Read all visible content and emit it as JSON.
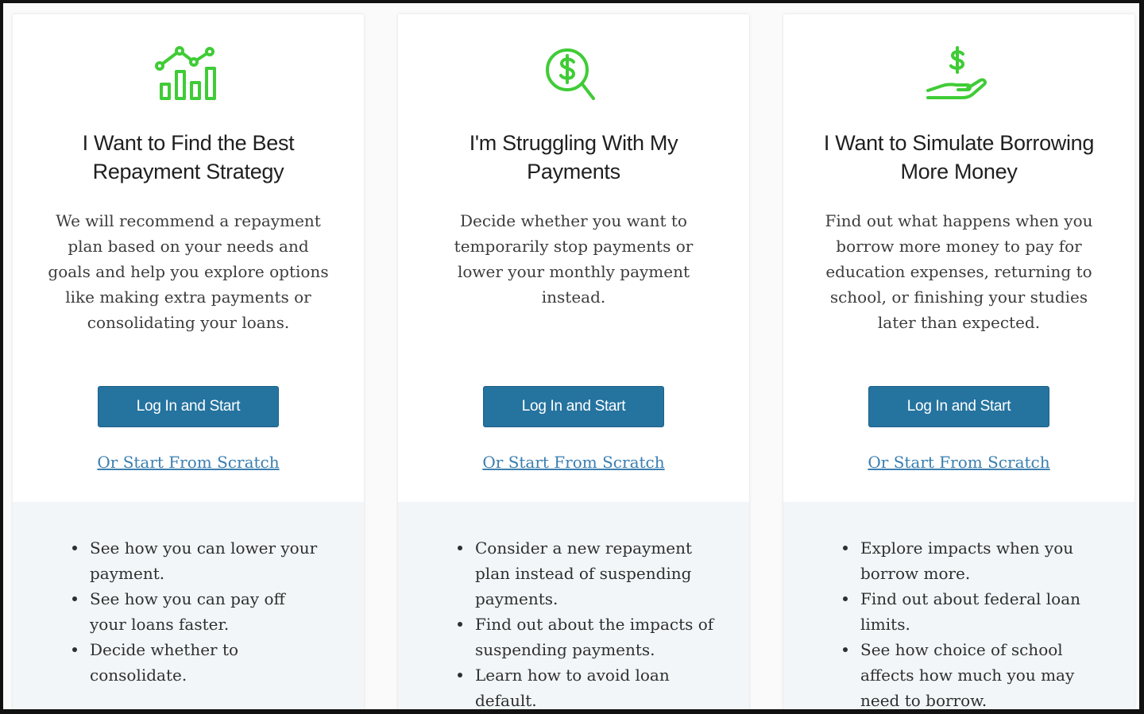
{
  "cards": [
    {
      "icon": "bar-chart-trend-icon",
      "title": "I Want to Find the Best Repayment Strategy",
      "description": "We will recommend a repayment plan based on your needs and goals and help you explore options like making extra payments or consolidating your loans.",
      "button_label": "Log In and Start",
      "link_label": "Or Start From Scratch",
      "bullets": [
        "See how you can lower your payment.",
        "See how you can pay off your loans faster.",
        "Decide whether to consolidate."
      ]
    },
    {
      "icon": "dollar-magnifier-icon",
      "title": "I'm Struggling With My Payments",
      "description": "Decide whether you want to temporarily stop payments or lower your monthly payment instead.",
      "button_label": "Log In and Start",
      "link_label": "Or Start From Scratch",
      "bullets": [
        "Consider a new repayment plan instead of suspending payments.",
        "Find out about the impacts of suspending payments.",
        "Learn how to avoid loan default."
      ]
    },
    {
      "icon": "hand-dollar-icon",
      "title": "I Want to Simulate Borrowing More Money",
      "description": "Find out what happens when you borrow more money to pay for education expenses, returning to school, or finishing your studies later than expected.",
      "button_label": "Log In and Start",
      "link_label": "Or Start From Scratch",
      "bullets": [
        "Explore impacts when you borrow more.",
        "Find out about federal loan limits.",
        "See how choice of school affects how much you may need to borrow."
      ]
    }
  ],
  "colors": {
    "accent_green": "#3fcc36",
    "button_blue": "#25739f",
    "link_blue": "#3b7fb0",
    "bullet_panel": "#f2f6f9"
  }
}
